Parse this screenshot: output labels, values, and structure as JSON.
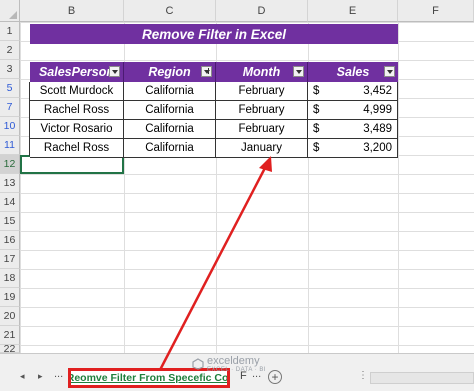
{
  "columns": [
    "B",
    "C",
    "D",
    "E",
    "F"
  ],
  "rows": [
    "1",
    "2",
    "3",
    "5",
    "7",
    "10",
    "11",
    "12",
    "13",
    "14",
    "15",
    "16",
    "17",
    "18",
    "19",
    "20",
    "21",
    "22"
  ],
  "title": "Remove Filter in Excel",
  "table": {
    "headers": [
      "SalesPerson",
      "Region",
      "Month",
      "Sales"
    ],
    "rows": [
      {
        "person": "Scott Murdock",
        "region": "California",
        "month": "February",
        "currency": "$",
        "sales": "3,452"
      },
      {
        "person": "Rachel Ross",
        "region": "California",
        "month": "February",
        "currency": "$",
        "sales": "4,999"
      },
      {
        "person": "Victor Rosario",
        "region": "California",
        "month": "February",
        "currency": "$",
        "sales": "3,489"
      },
      {
        "person": "Rachel Ross",
        "region": "California",
        "month": "January",
        "currency": "$",
        "sales": "3,200"
      }
    ]
  },
  "sheet_tabs": {
    "nav_prev": "◂",
    "nav_next": "▸",
    "ellipsis_left": "...",
    "active": "Reomve Filter From Specefic Col",
    "next_partial": "F",
    "ellipsis_right": "...",
    "add": "+"
  },
  "watermark": {
    "name": "exceldemy",
    "tagline": "EXCEL · DATA · BI"
  },
  "colors": {
    "header_purple": "#7030a0",
    "annotation_red": "#e02020",
    "tab_green": "#1e7f3c"
  }
}
